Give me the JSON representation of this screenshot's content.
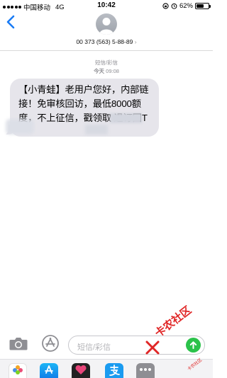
{
  "status_bar": {
    "carrier": "中国移动",
    "network": "4G",
    "time": "10:42",
    "battery_percent": "62%",
    "battery_level": 0.62
  },
  "contact": {
    "number": "00 373 (563) 5-88-89",
    "chevron": "›"
  },
  "thread": {
    "label": "短信/彩信",
    "day": "今天",
    "time": "09:08"
  },
  "message": {
    "text": "【小青蛙】老用户您好，内部链接！免审核回访，最低8000额度，不上征信，戳领取 退订回T"
  },
  "compose": {
    "placeholder": "短信/彩信"
  },
  "watermark": {
    "main": "卡农社区",
    "sub": "卡农社区"
  },
  "icons": {
    "back": "chevron-left-icon",
    "camera": "camera-icon",
    "appstore": "app-store-icon",
    "send": "arrow-up-icon",
    "photos": "photos-icon",
    "alipay": "alipay-icon",
    "more": "more-icon"
  },
  "colors": {
    "accent": "#1a7cf5",
    "bubble": "#e6e5eb",
    "send": "#2bc24a",
    "watermark": "#e02626"
  }
}
